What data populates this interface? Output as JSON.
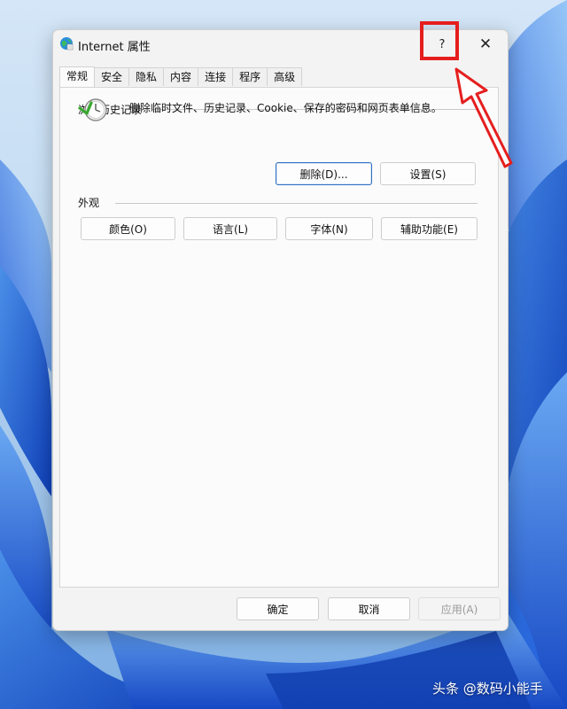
{
  "window": {
    "title": "Internet 属性",
    "help_label": "?",
    "close_label": "✕"
  },
  "tabs": [
    {
      "label": "常规",
      "active": true
    },
    {
      "label": "安全",
      "active": false
    },
    {
      "label": "隐私",
      "active": false
    },
    {
      "label": "内容",
      "active": false
    },
    {
      "label": "连接",
      "active": false
    },
    {
      "label": "程序",
      "active": false
    },
    {
      "label": "高级",
      "active": false
    }
  ],
  "history": {
    "header": "浏览历史记录",
    "description": "删除临时文件、历史记录、Cookie、保存的密码和网页表单信息。",
    "delete_label": "删除(D)...",
    "settings_label": "设置(S)"
  },
  "appearance": {
    "header": "外观",
    "colors_label": "颜色(O)",
    "languages_label": "语言(L)",
    "fonts_label": "字体(N)",
    "accessibility_label": "辅助功能(E)"
  },
  "footer": {
    "ok_label": "确定",
    "cancel_label": "取消",
    "apply_label": "应用(A)"
  },
  "watermark": "头条 @数码小能手",
  "colors": {
    "annotation": "#e51e1e",
    "default_button_border": "#2f6fc0",
    "wallpaper_blue": "#1b5fd6"
  },
  "icons": [
    "globe-icon",
    "history-clock-icon",
    "help-icon",
    "close-icon"
  ]
}
